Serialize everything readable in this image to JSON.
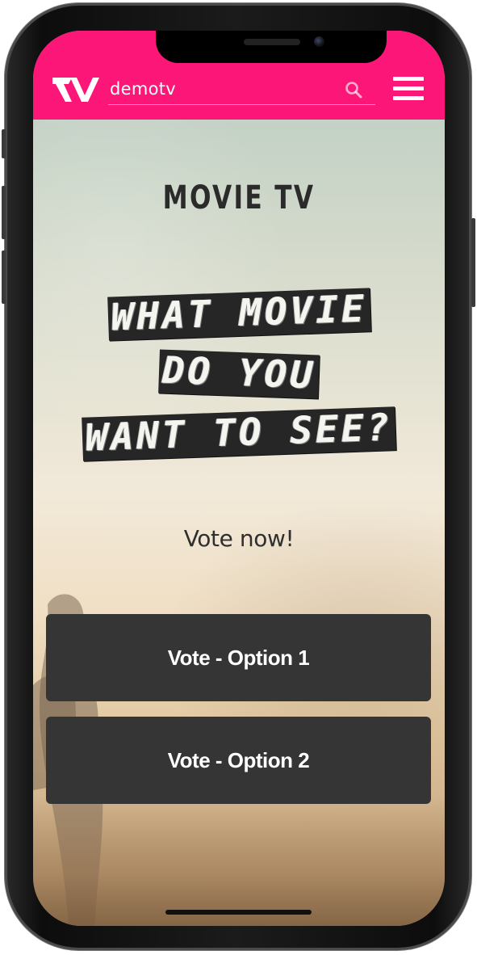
{
  "topbar": {
    "site_name": "demotv",
    "logo_icon": "tv-logo-icon",
    "search_icon": "search-icon",
    "menu_icon": "hamburger-menu-icon",
    "color": "#fc1677"
  },
  "main": {
    "app_title": "MOVIE TV",
    "headline": {
      "line1": "WHAT MOVIE",
      "line2": "DO YOU",
      "line3": "WANT TO SEE?"
    },
    "vote_prompt": "Vote now!",
    "buttons": [
      {
        "label": "Vote - Option 1"
      },
      {
        "label": "Vote - Option 2"
      }
    ]
  },
  "colors": {
    "brand_pink": "#fc1677",
    "button_bg": "#353535",
    "button_text": "#ffffff"
  }
}
